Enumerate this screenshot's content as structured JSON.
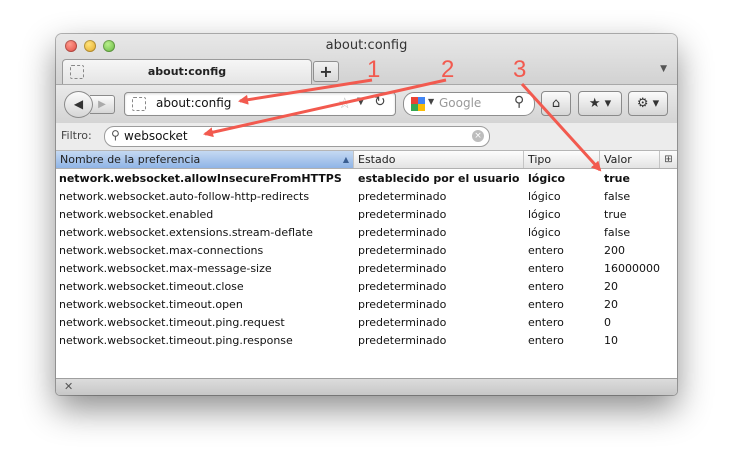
{
  "window": {
    "title": "about:config"
  },
  "tabs": [
    {
      "label": "about:config"
    }
  ],
  "newtab_label": "+",
  "navbar": {
    "url": "about:config",
    "search_placeholder": "Google"
  },
  "filter": {
    "label": "Filtro:",
    "value": "websocket"
  },
  "table": {
    "columns": [
      "Nombre de la preferencia",
      "Estado",
      "Tipo",
      "Valor"
    ],
    "rows": [
      {
        "name": "network.websocket.allowInsecureFromHTTPS",
        "estado": "establecido por el usuario",
        "tipo": "lógico",
        "valor": "true"
      },
      {
        "name": "network.websocket.auto-follow-http-redirects",
        "estado": "predeterminado",
        "tipo": "lógico",
        "valor": "false"
      },
      {
        "name": "network.websocket.enabled",
        "estado": "predeterminado",
        "tipo": "lógico",
        "valor": "true"
      },
      {
        "name": "network.websocket.extensions.stream-deflate",
        "estado": "predeterminado",
        "tipo": "lógico",
        "valor": "false"
      },
      {
        "name": "network.websocket.max-connections",
        "estado": "predeterminado",
        "tipo": "entero",
        "valor": "200"
      },
      {
        "name": "network.websocket.max-message-size",
        "estado": "predeterminado",
        "tipo": "entero",
        "valor": "16000000"
      },
      {
        "name": "network.websocket.timeout.close",
        "estado": "predeterminado",
        "tipo": "entero",
        "valor": "20"
      },
      {
        "name": "network.websocket.timeout.open",
        "estado": "predeterminado",
        "tipo": "entero",
        "valor": "20"
      },
      {
        "name": "network.websocket.timeout.ping.request",
        "estado": "predeterminado",
        "tipo": "entero",
        "valor": "0"
      },
      {
        "name": "network.websocket.timeout.ping.response",
        "estado": "predeterminado",
        "tipo": "entero",
        "valor": "10"
      }
    ]
  },
  "annotations": [
    "1",
    "2",
    "3"
  ],
  "colors": {
    "annotation_red": "#f25a4f",
    "sorted_header": "#a9c6ee"
  },
  "icons": [
    "back-arrow-icon",
    "forward-arrow-icon",
    "bookmark-star-icon",
    "reload-icon",
    "google-icon",
    "search-icon",
    "home-icon",
    "bookmarks-icon",
    "tools-icon",
    "close-icon"
  ]
}
